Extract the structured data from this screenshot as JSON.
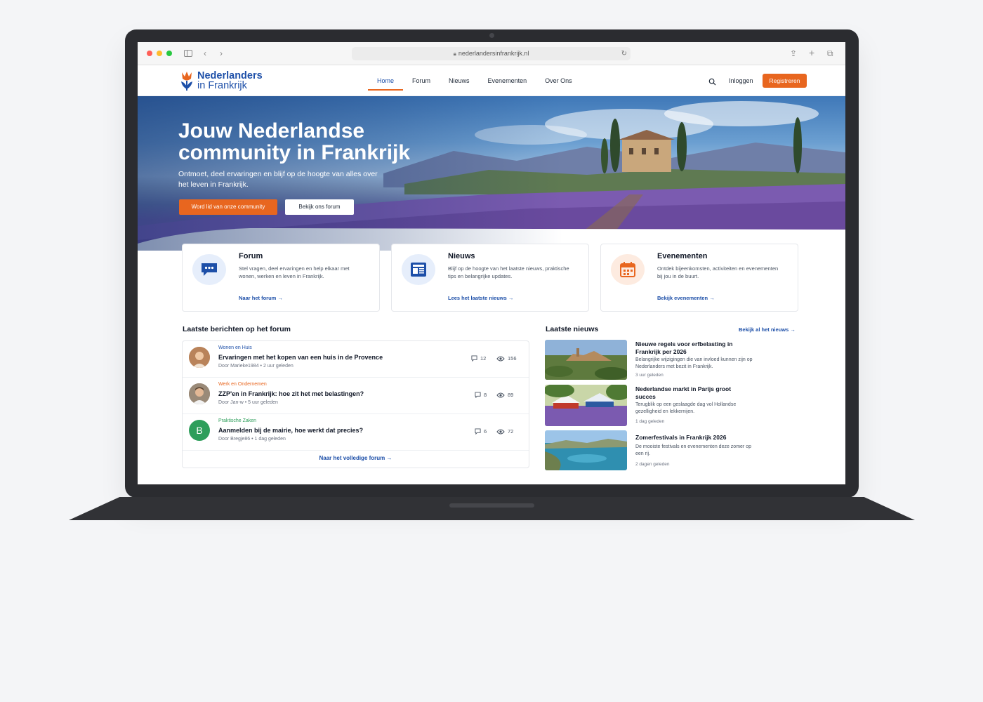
{
  "browser": {
    "url": "nederlandersinfrankrijk.nl"
  },
  "site": {
    "logo_line1": "Nederlanders",
    "logo_line2": "in Frankrijk",
    "nav": [
      "Home",
      "Forum",
      "Nieuws",
      "Evenementen",
      "Over Ons"
    ],
    "active_nav": "Home",
    "login": "Inloggen",
    "register": "Registreren",
    "accent": "#e8661f",
    "brand": "#1d4fa8"
  },
  "hero": {
    "title": "Jouw Nederlandse community in Frankrijk",
    "subtitle": "Ontmoet, deel ervaringen en blijf op de hoogte van alles over het leven in Frankrijk.",
    "cta_primary": "Word lid van onze community",
    "cta_secondary": "Bekijk ons forum"
  },
  "features": [
    {
      "icon": "chat-bubble-icon",
      "title": "Forum",
      "desc": "Stel vragen, deel ervaringen en help elkaar met wonen, werken en leven in Frankrijk.",
      "link": "Naar het forum →"
    },
    {
      "icon": "newspaper-icon",
      "title": "Nieuws",
      "desc": "Blijf op de hoogte van het laatste nieuws, praktische tips en belangrijke updates.",
      "link": "Lees het laatste nieuws →"
    },
    {
      "icon": "calendar-icon",
      "title": "Evenementen",
      "desc": "Ontdek bijeenkomsten, activiteiten en evenementen bij jou in de buurt.",
      "link": "Bekijk evenementen →"
    }
  ],
  "forum": {
    "heading": "Laatste berichten op het forum",
    "posts": [
      {
        "category": "Wonen en Huis",
        "category_color": "#1d4fa8",
        "title": "Ervaringen met het kopen van een huis in de Provence",
        "author": "Door Marieke1984",
        "time": "2 uur geleden",
        "comments": "12",
        "views": "156"
      },
      {
        "category": "Werk en Ondernemen",
        "category_color": "#e8661f",
        "title": "ZZP'en in Frankrijk: hoe zit het met belastingen?",
        "author": "Door Jan-w",
        "time": "5 uur geleden",
        "comments": "8",
        "views": "89"
      },
      {
        "category": "Praktische Zaken",
        "category_color": "#2e9e5b",
        "title": "Aanmelden bij de mairie, hoe werkt dat precies?",
        "author": "Door Bregje86",
        "time": "1 dag geleden",
        "comments": "6",
        "views": "72",
        "avatar_letter": "B"
      }
    ],
    "all_link": "Naar het volledige forum →"
  },
  "news": {
    "heading": "Laatste nieuws",
    "all_link": "Bekijk al het nieuws →",
    "items": [
      {
        "title": "Nieuwe regels voor erfbelasting in Frankrijk per 2026",
        "desc": "Belangrijke wijzigingen die van invloed kunnen zijn op Nederlanders met bezit in Frankrijk.",
        "time": "3 uur geleden"
      },
      {
        "title": "Nederlandse markt in Parijs groot succes",
        "desc": "Terugblik op een geslaagde dag vol Hollandse gezelligheid en lekkernijen.",
        "time": "1 dag geleden"
      },
      {
        "title": "Zomerfestivals in Frankrijk 2026",
        "desc": "De mooiste festivals en evenementen deze zomer op een rij.",
        "time": "2 dagen geleden"
      }
    ]
  }
}
